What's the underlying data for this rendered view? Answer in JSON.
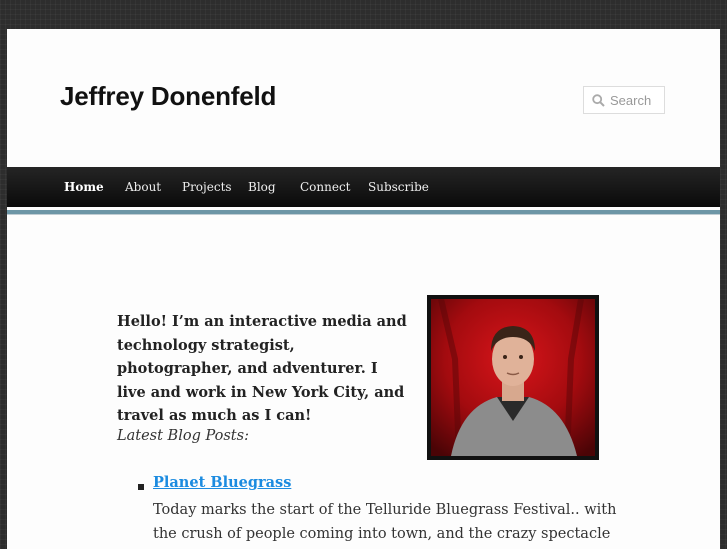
{
  "site": {
    "title": "Jeffrey Donenfeld"
  },
  "search": {
    "placeholder": "Search",
    "icon": "search-icon"
  },
  "nav": {
    "items": [
      {
        "label": "Home",
        "active": true
      },
      {
        "label": "About"
      },
      {
        "label": "Projects"
      },
      {
        "label": "Blog"
      },
      {
        "label": "Connect"
      },
      {
        "label": "Subscribe"
      }
    ]
  },
  "main": {
    "intro": "Hello! I’m an interactive media and technology strategist, photographer, and adventurer. I live and work in New York City, and travel as much as I can!",
    "latest_heading": "Latest Blog Posts:",
    "posts": [
      {
        "title": "Planet Bluegrass",
        "excerpt": "Today marks the start of the Telluride Bluegrass Festival.. with the crush of people coming into town, and the crazy spectacle of a large portion of"
      }
    ]
  },
  "colors": {
    "link": "#1b8be0",
    "accent_stripe": "#6d96a6",
    "nav_bg": "#1a1a1a"
  }
}
